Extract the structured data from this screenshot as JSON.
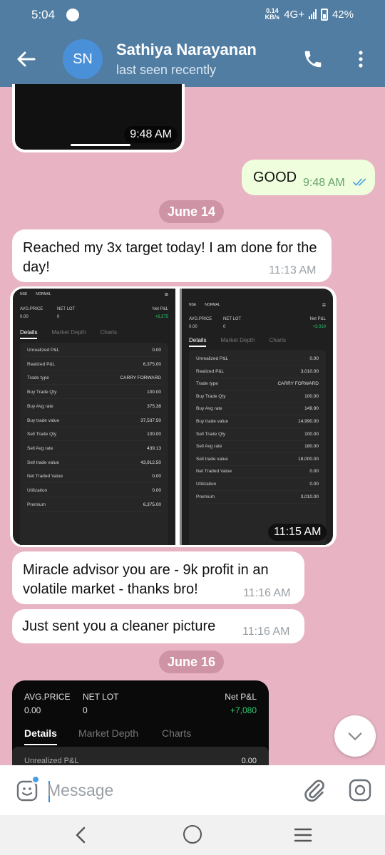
{
  "status_bar": {
    "time": "5:04",
    "speed_value": "0.14",
    "speed_unit": "KB/s",
    "network": "4G+",
    "battery": "42%"
  },
  "header": {
    "avatar_initials": "SN",
    "contact_name": "Sathiya Narayanan",
    "contact_status": "last seen recently"
  },
  "messages": {
    "photo1_time": "9:48 AM",
    "good_text": "GOOD",
    "good_time": "9:48 AM",
    "date1": "June 14",
    "target_text": "Reached my 3x target today! I am done for the day!",
    "target_time": "11:13 AM",
    "shots_time": "11:15 AM",
    "miracle_text": "Miracle advisor you are - 9k profit in an volatile market - thanks bro!",
    "miracle_time": "11:16 AM",
    "cleaner_text": "Just sent you a cleaner picture",
    "cleaner_time": "11:16 AM",
    "date2": "June 16"
  },
  "shot_left": {
    "top": [
      "NSE",
      "NORMAL"
    ],
    "avg_label": "AVG.PRICE",
    "avg_value": "0.00",
    "lot_label": "NET LOT",
    "lot_value": "0",
    "pnl_label": "Net P&L",
    "pnl_value": "+6,375",
    "tabs": [
      "Details",
      "Market Depth",
      "Charts"
    ],
    "rows": [
      {
        "label": "Unrealized P&L",
        "value": "0.00"
      },
      {
        "label": "Realized P&L",
        "value": "6,375.00"
      },
      {
        "label": "Trade type",
        "value": "CARRY FORWARD"
      },
      {
        "label": "Buy Trade Qty",
        "value": "100.00"
      },
      {
        "label": "Buy Avg rate",
        "value": "375.38"
      },
      {
        "label": "Buy trade value",
        "value": "37,537.50"
      },
      {
        "label": "Sell Trade Qty",
        "value": "100.00"
      },
      {
        "label": "Sell Avg rate",
        "value": "439.13"
      },
      {
        "label": "Sell trade value",
        "value": "43,912.50"
      },
      {
        "label": "Net Traded Value",
        "value": "0.00"
      },
      {
        "label": "Utilization",
        "value": "0.00"
      },
      {
        "label": "Premium",
        "value": "6,375.00"
      }
    ]
  },
  "shot_right": {
    "top": [
      "NSE",
      "NORMAL"
    ],
    "avg_label": "AVG.PRICE",
    "avg_value": "0.00",
    "lot_label": "NET LOT",
    "lot_value": "0",
    "pnl_label": "Net P&L",
    "pnl_value": "+3,010",
    "tabs": [
      "Details",
      "Market Depth",
      "Charts"
    ],
    "rows": [
      {
        "label": "Unrealized P&L",
        "value": "0.00"
      },
      {
        "label": "Realized P&L",
        "value": "3,010.00"
      },
      {
        "label": "Trade type",
        "value": "CARRY FORWARD"
      },
      {
        "label": "Buy Trade Qty",
        "value": "100.00"
      },
      {
        "label": "Buy Avg rate",
        "value": "149.90"
      },
      {
        "label": "Buy trade value",
        "value": "14,990.00"
      },
      {
        "label": "Sell Trade Qty",
        "value": "100.00"
      },
      {
        "label": "Sell Avg rate",
        "value": "180.00"
      },
      {
        "label": "Sell trade value",
        "value": "18,000.00"
      },
      {
        "label": "Net Traded Value",
        "value": "0.00"
      },
      {
        "label": "Utilization",
        "value": "0.00"
      },
      {
        "label": "Premium",
        "value": "3,010.00"
      }
    ]
  },
  "shot_big": {
    "avg_label": "AVG.PRICE",
    "avg_value": "0.00",
    "lot_label": "NET LOT",
    "lot_value": "0",
    "pnl_label": "Net P&L",
    "pnl_value": "+7,080",
    "tabs": [
      "Details",
      "Market Depth",
      "Charts"
    ],
    "row_label": "Unrealized P&L",
    "row_value": "0.00"
  },
  "composer": {
    "placeholder": "Message"
  },
  "colors": {
    "header": "#517da2",
    "chat_bg": "#e8b4c4",
    "outgoing": "#effedd",
    "profit_green": "#2ecc71"
  }
}
